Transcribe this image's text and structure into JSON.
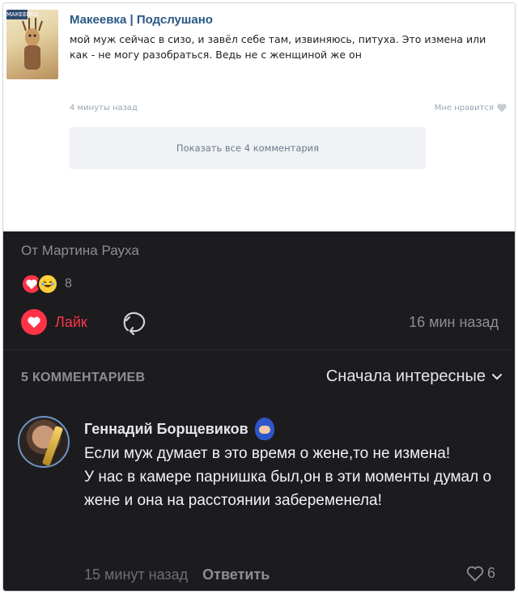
{
  "vk_post": {
    "avatar_tag": "МАКЕЕВКА",
    "title": "Макеевка | Подслушано",
    "text": "мой муж сейчас в сизо, и завёл себе там, извиняюсь, питуха. Это измена или как - не могу разобраться. Ведь не с женщиной же он",
    "time": "4 минуты назад",
    "like_label": "Мне нравится",
    "show_comments": "Показать все 4 комментария"
  },
  "post": {
    "from": "От Мартина Рауха",
    "reactions_count": "8",
    "like_label": "Лайк",
    "time": "16 мин назад"
  },
  "comments_header": {
    "title": "5 КОММЕНТАРИЕВ",
    "sort_label": "Сначала интересные"
  },
  "comment": {
    "author": "Геннадий Борщевиков",
    "text": "Если муж думает в это время о жене,то не измена!\nУ нас в камере парнишка был,он в эти моменты думал о жене и она на расстоянии забеременела!",
    "time": "15 минут назад",
    "reply_label": "Ответить",
    "likes": "6"
  },
  "colors": {
    "dark_bg": "#1c1c1e",
    "accent_red": "#ff3347",
    "vk_blue": "#2a5885"
  }
}
